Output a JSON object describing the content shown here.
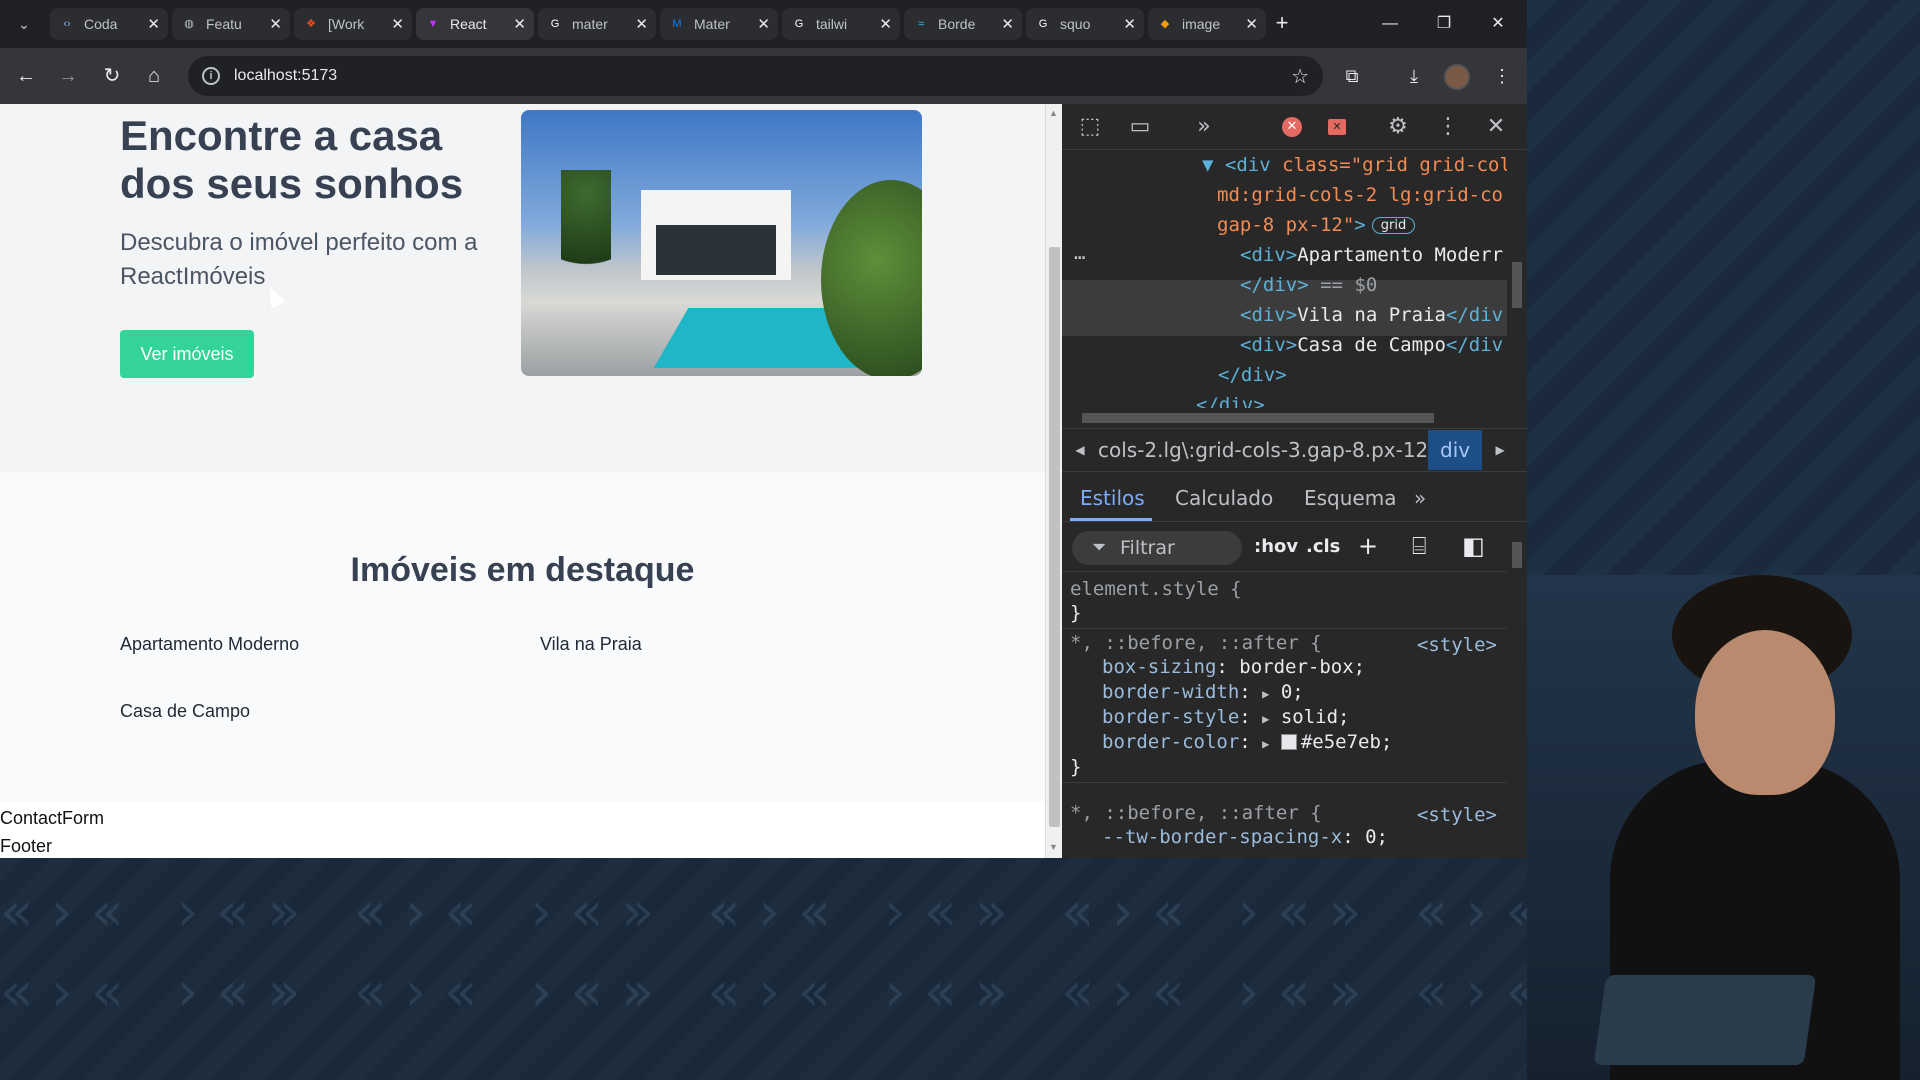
{
  "tabs": [
    {
      "label": "Coda",
      "icon": "code-icon",
      "color": "#8ab4f8"
    },
    {
      "label": "Featu",
      "icon": "globe-icon",
      "color": "#bdc1c6"
    },
    {
      "label": "[Work",
      "icon": "figma-icon",
      "color": "#f24e1e"
    },
    {
      "label": "React",
      "icon": "vite-icon",
      "color": "#bd34fe",
      "active": true
    },
    {
      "label": "mater",
      "icon": "google-icon",
      "color": "#ffffff"
    },
    {
      "label": "Mater",
      "icon": "mui-icon",
      "color": "#007fff"
    },
    {
      "label": "tailwi",
      "icon": "google-icon",
      "color": "#ffffff"
    },
    {
      "label": "Borde",
      "icon": "tailwind-icon",
      "color": "#38bdf8"
    },
    {
      "label": "squo",
      "icon": "google-icon",
      "color": "#ffffff"
    },
    {
      "label": "image",
      "icon": "image-icon",
      "color": "#f59e0b"
    }
  ],
  "address": {
    "url": "localhost:5173"
  },
  "page": {
    "hero_title": "Encontre a casa dos seus sonhos",
    "hero_subtitle": "Descubra o imóvel perfeito com a ReactImóveis",
    "cta_label": "Ver imóveis",
    "featured_title": "Imóveis em destaque",
    "properties": [
      "Apartamento Moderno",
      "Vila na Praia",
      "Casa de Campo"
    ],
    "contact_form": "ContactForm",
    "footer": "Footer",
    "accent_color": "#34d399"
  },
  "devtools": {
    "elements": {
      "line1_tag": "<div ",
      "line1_attr": "class=\"grid grid-col",
      "line2": "md:grid-cols-2 lg:grid-co",
      "line3": "gap-8 px-12\"",
      "line3_end": ">",
      "grid_badge": "grid",
      "selected_open": "<div>",
      "selected_text": "Apartamento Moderr",
      "selected_close": "</div>",
      "selected_marker": " == $0",
      "row2_open": "<div>",
      "row2_text": "Vila na Praia",
      "row2_close": "</div",
      "row3_open": "<div>",
      "row3_text": "Casa de Campo",
      "row3_close": "</div",
      "close1": "</div>",
      "close2": "</div>",
      "ellipsis": "…"
    },
    "breadcrumb": {
      "path": "cols-2.lg\\:grid-cols-3.gap-8.px-12",
      "selected": "div"
    },
    "style_tabs": [
      "Estilos",
      "Calculado",
      "Esquema"
    ],
    "filter_placeholder": "Filtrar",
    "hov": ":hov",
    "cls": ".cls",
    "rules": {
      "element_style": "element.style {",
      "close_brace": "}",
      "universal_selector": "*, ::before, ::after {",
      "source": "<style>",
      "decls": [
        {
          "prop": "box-sizing",
          "value": "border-box;"
        },
        {
          "prop": "border-width",
          "value": "0;"
        },
        {
          "prop": "border-style",
          "value": "solid;"
        },
        {
          "prop": "border-color",
          "value": "#e5e7eb;"
        }
      ],
      "next_decl_prop": "--tw-border-spacing-x",
      "next_decl_value": "0;"
    }
  }
}
